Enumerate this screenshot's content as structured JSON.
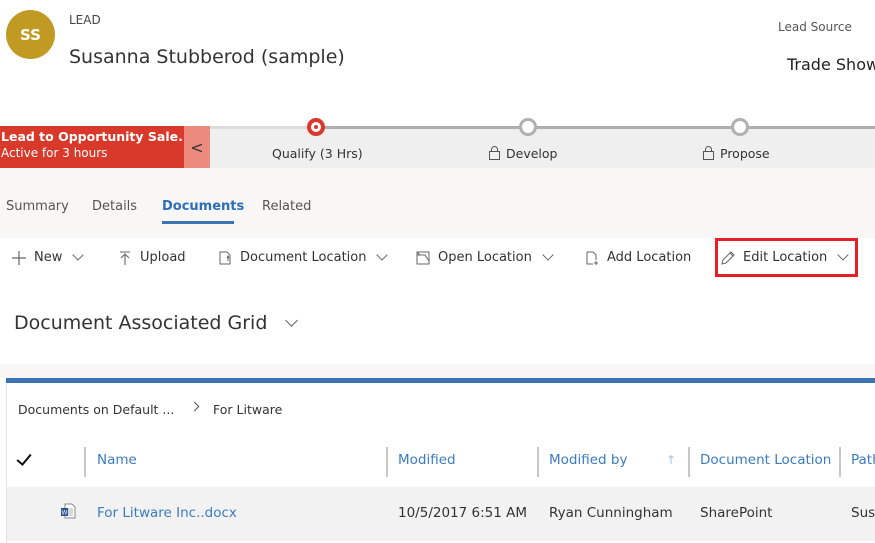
{
  "header": {
    "avatar_initials": "SS",
    "avatar_color": "#c19a24",
    "entity_type": "LEAD",
    "record_name": "Susanna Stubberod (sample)",
    "fields": [
      {
        "label": "Lead Source",
        "value": "Trade Show"
      }
    ]
  },
  "process": {
    "name": "Lead to Opportunity Sale...",
    "status": "Active for 3 hours",
    "color": "#d9392a",
    "collapse_glyph": "<",
    "stages": [
      {
        "label": "Qualify  (3 Hrs)",
        "state": "active",
        "locked": false
      },
      {
        "label": "Develop",
        "state": "inactive",
        "locked": true
      },
      {
        "label": "Propose",
        "state": "inactive",
        "locked": true
      }
    ]
  },
  "tabs": [
    {
      "label": "Summary",
      "active": false
    },
    {
      "label": "Details",
      "active": false
    },
    {
      "label": "Documents",
      "active": true
    },
    {
      "label": "Related",
      "active": false
    }
  ],
  "commands": [
    {
      "label": "New",
      "icon": "plus-icon",
      "dropdown": true
    },
    {
      "label": "Upload",
      "icon": "upload-icon",
      "dropdown": false
    },
    {
      "label": "Document Location",
      "icon": "document-location-icon",
      "dropdown": true
    },
    {
      "label": "Open Location",
      "icon": "open-location-icon",
      "dropdown": true
    },
    {
      "label": "Add Location",
      "icon": "add-location-icon",
      "dropdown": false
    },
    {
      "label": "Edit Location",
      "icon": "pencil-icon",
      "dropdown": true,
      "highlighted": true
    }
  ],
  "highlight_color": "#e61e25",
  "grid": {
    "title": "Document Associated Grid",
    "breadcrumb": [
      "Documents on Default ...",
      "For Litware"
    ],
    "columns": [
      "Name",
      "Modified",
      "Modified by",
      "Document Location",
      "Path"
    ],
    "sorted_column": "Modified by",
    "sort_direction": "ascending",
    "rows": [
      {
        "file_type": "word-document",
        "name": "For Litware Inc..docx",
        "modified": "10/5/2017 6:51 AM",
        "modified_by": "Ryan Cunningham",
        "document_location": "SharePoint",
        "path": "Sus"
      }
    ]
  }
}
